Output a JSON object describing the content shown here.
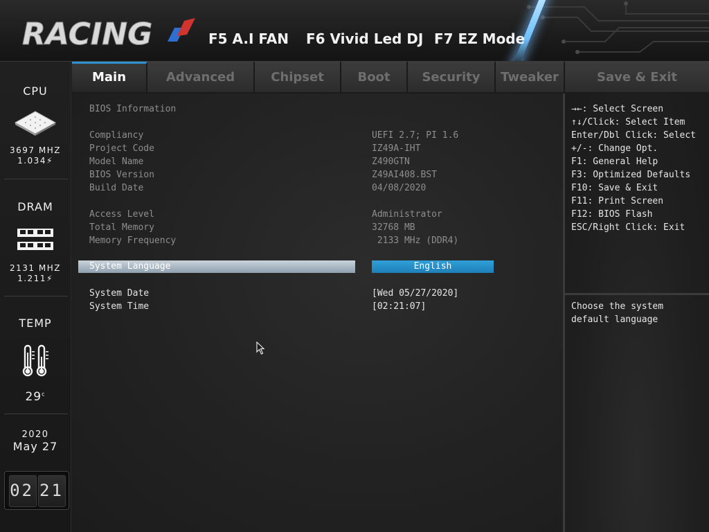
{
  "header": {
    "logo_text": "RACING",
    "hotkeys": [
      "F5 A.I FAN",
      "F6 Vivid Led DJ",
      "F7 EZ Mode"
    ]
  },
  "sidebar": {
    "cpu": {
      "title": "CPU",
      "freq": "3697 MHZ",
      "volt": "1.034"
    },
    "dram": {
      "title": "DRAM",
      "freq": "2131 MHZ",
      "volt": "1.211"
    },
    "temp": {
      "title": "TEMP",
      "value": "29",
      "unit": "c"
    },
    "date": {
      "year": "2020",
      "month_day": "May 27"
    },
    "clock": {
      "hh": "02",
      "mm": "21"
    }
  },
  "tabs": [
    {
      "label": "Main",
      "active": true
    },
    {
      "label": "Advanced"
    },
    {
      "label": "Chipset"
    },
    {
      "label": "Boot"
    },
    {
      "label": "Security"
    },
    {
      "label": "Tweaker"
    },
    {
      "label": "Save & Exit"
    }
  ],
  "main": {
    "section_title": "BIOS Information",
    "info": [
      {
        "label": "Compliancy",
        "value": "UEFI 2.7; PI 1.6"
      },
      {
        "label": "Project Code",
        "value": "IZ49A-IHT"
      },
      {
        "label": "Model Name",
        "value": "Z490GTN"
      },
      {
        "label": "BIOS Version",
        "value": "Z49AI408.BST"
      },
      {
        "label": "Build Date",
        "value": "04/08/2020"
      }
    ],
    "info2": [
      {
        "label": "Access Level",
        "value": "Administrator"
      },
      {
        "label": "Total Memory",
        "value": "32768 MB"
      },
      {
        "label": "Memory Frequency",
        "value": " 2133 MHz (DDR4)"
      }
    ],
    "language": {
      "label": "System Language",
      "value": "English"
    },
    "date": {
      "label": "System Date",
      "value": "[Wed 05/27/2020]"
    },
    "time": {
      "label": "System Time",
      "value": "[02:21:07]"
    }
  },
  "help": {
    "keys": [
      ": Select Screen",
      "/Click: Select Item",
      "Enter/Dbl Click: Select",
      "+/-: Change Opt.",
      "F1: General Help",
      "F3: Optimized Defaults",
      "F10: Save & Exit",
      "F11: Print Screen",
      "F12: BIOS Flash",
      "ESC/Right Click: Exit"
    ],
    "key_icons": [
      "left-right-arrows-icon",
      "up-down-arrows-icon"
    ],
    "description": [
      "Choose the system",
      "default language"
    ]
  },
  "colors": {
    "accent_blue": "#2f8fcf",
    "selected_value_bg": "#1f7fb8",
    "highlight_bar": "#b4c2cd"
  }
}
